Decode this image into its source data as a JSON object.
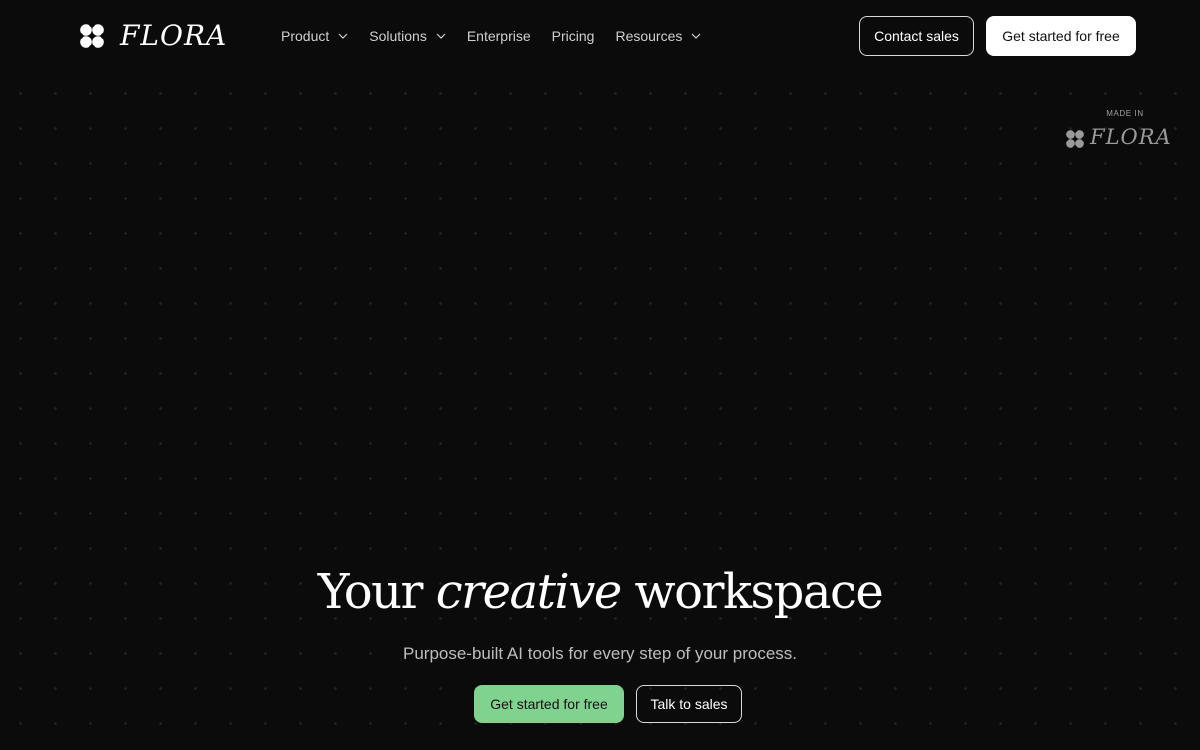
{
  "brand": {
    "name": "FLORA",
    "logo_icon": "four-petal-flower-icon",
    "colors": {
      "background": "#0b0b0b",
      "accent_green": "#7fd38f",
      "text": "#ffffff",
      "muted_text": "#bdbdbd"
    }
  },
  "nav": {
    "items": [
      {
        "label": "Product",
        "has_dropdown": true
      },
      {
        "label": "Solutions",
        "has_dropdown": true
      },
      {
        "label": "Enterprise",
        "has_dropdown": false
      },
      {
        "label": "Pricing",
        "has_dropdown": false
      },
      {
        "label": "Resources",
        "has_dropdown": true
      }
    ],
    "dropdown_icon": "chevron-down-icon"
  },
  "header_actions": {
    "contact_label": "Contact sales",
    "start_label": "Get started for free"
  },
  "badge": {
    "caption": "MADE IN",
    "brand": "FLORA"
  },
  "hero": {
    "title_pre": "Your ",
    "title_em": "creative",
    "title_post": " workspace",
    "subtitle": "Purpose-built AI tools for every step of your process.",
    "cta_primary": "Get started for free",
    "cta_secondary": "Talk to sales"
  }
}
